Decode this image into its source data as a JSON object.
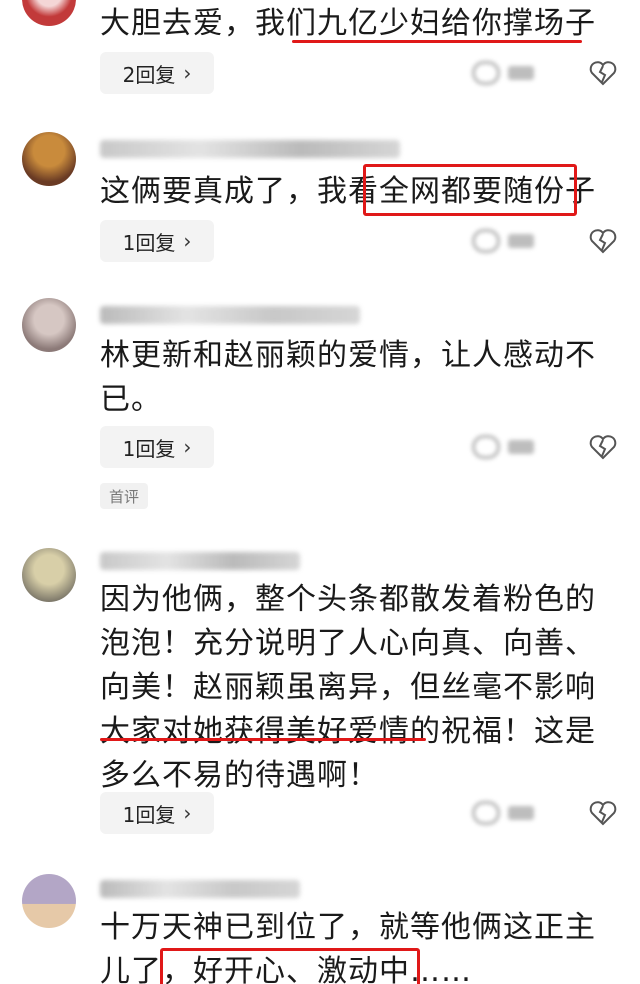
{
  "comments": [
    {
      "text": "大胆去爱，我们九亿少妇给你撑场子",
      "reply_label": "2回复",
      "avatar_colors": [
        "#c23a3a",
        "#f4d6d6"
      ]
    },
    {
      "text": "这俩要真成了，我看全网都要随份子",
      "reply_label": "1回复",
      "avatar_colors": [
        "#c98b3c",
        "#6a3b24"
      ]
    },
    {
      "text": "林更新和赵丽颖的爱情，让人感动不已。",
      "reply_label": "1回复",
      "avatar_colors": [
        "#8c7a78",
        "#d6c7c3"
      ],
      "tag": "首评"
    },
    {
      "text": "因为他俩，整个头条都散发着粉色的泡泡！充分说明了人心向真、向善、向美！赵丽颖虽离异，但丝毫不影响大家对她获得美好爱情的祝福！这是多么不易的待遇啊！",
      "reply_label": "1回复",
      "avatar_colors": [
        "#d8cfa8",
        "#7f7a6b"
      ]
    },
    {
      "text": "十万天神已到位了，就等他俩这正主儿了，好开心、激动中……",
      "avatar_colors": [
        "#b3a6c6",
        "#e6c9a8"
      ]
    }
  ],
  "icons": {
    "reply_chevron": "chevron-right-icon",
    "like": "like-icon",
    "dislike": "broken-heart-icon"
  },
  "colors": {
    "highlight": "#e01818",
    "reply_bg": "#f3f3f3"
  }
}
